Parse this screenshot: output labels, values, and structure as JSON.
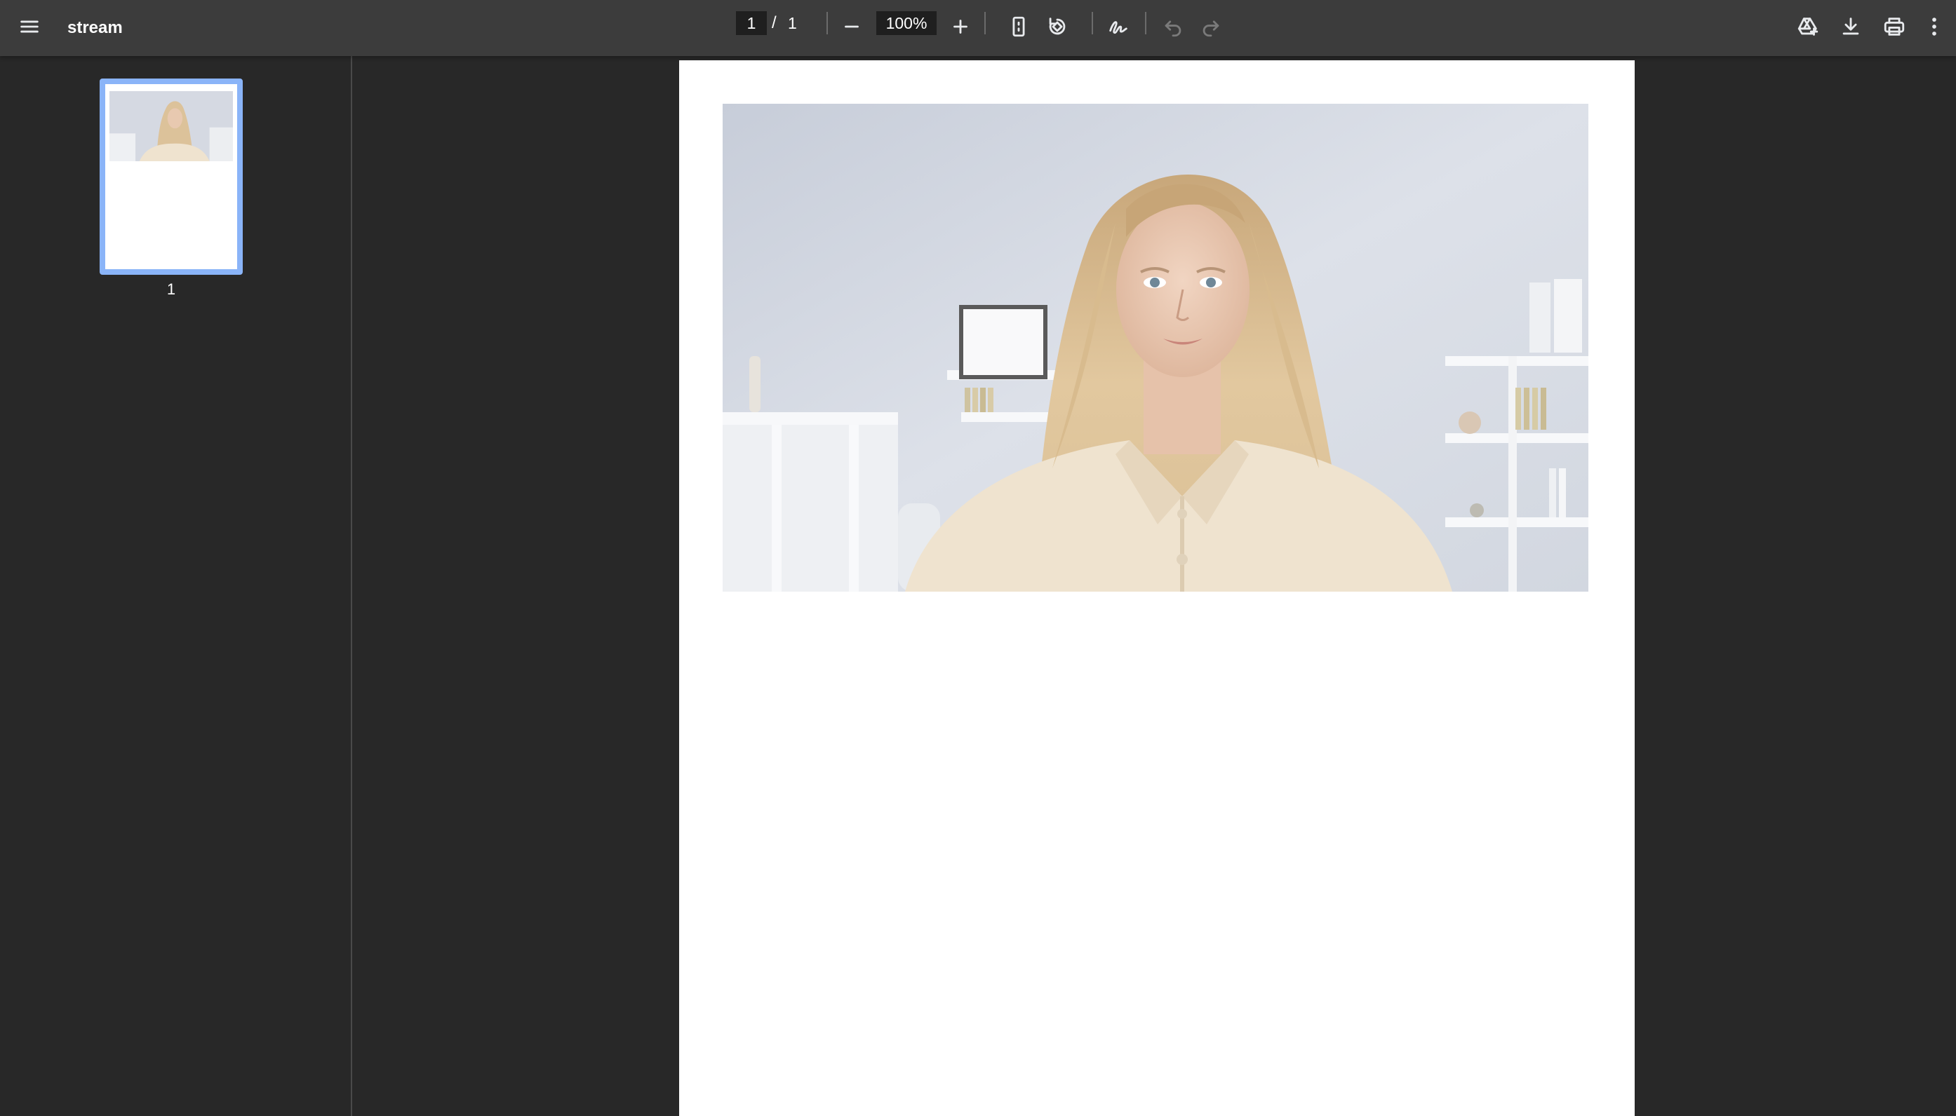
{
  "toolbar": {
    "title": "stream",
    "page_current": "1",
    "page_separator": "/",
    "page_total": "1",
    "zoom": "100%"
  },
  "sidebar": {
    "thumbnails": [
      {
        "label": "1",
        "selected": true
      }
    ]
  },
  "colors": {
    "toolbar_bg": "#3c3c3c",
    "viewer_bg": "#282828",
    "thumbnail_selected_border": "#8ab4f8",
    "page_bg": "#ffffff"
  },
  "icons": [
    "menu-icon",
    "zoom-out-icon",
    "zoom-in-icon",
    "fit-page-icon",
    "rotate-icon",
    "annotate-icon",
    "undo-icon",
    "redo-icon",
    "save-to-drive-icon",
    "download-icon",
    "print-icon",
    "more-vert-icon"
  ]
}
